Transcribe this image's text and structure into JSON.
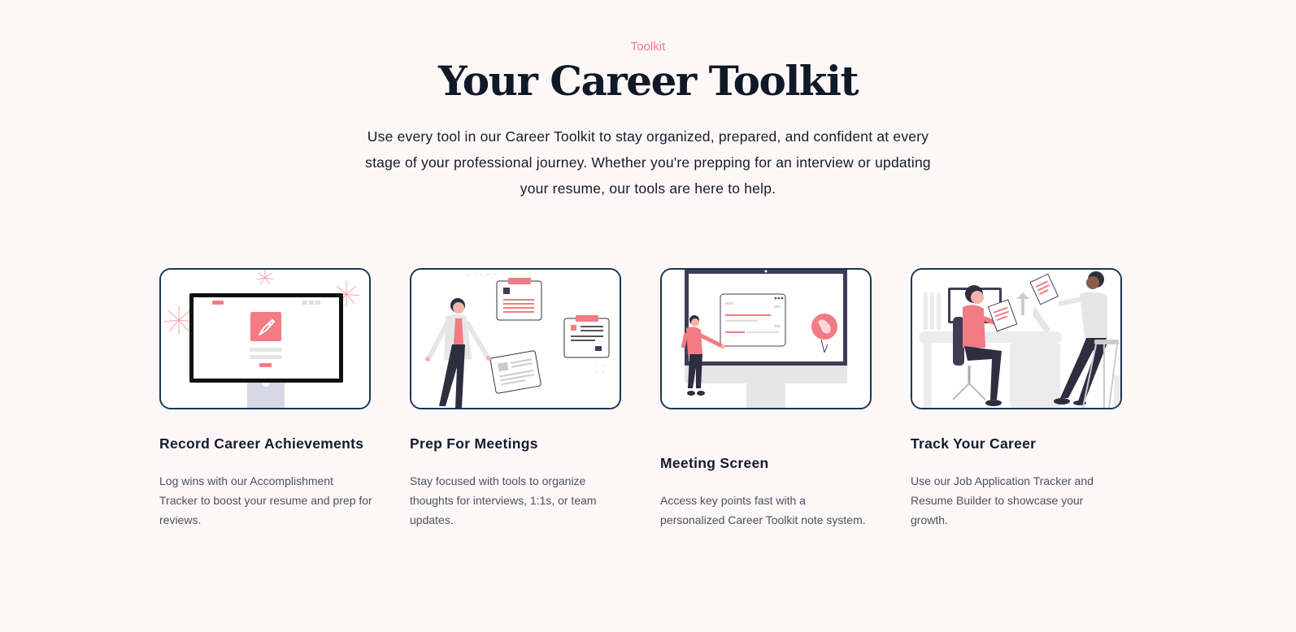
{
  "section": {
    "eyebrow": "Toolkit",
    "title": "Your Career Toolkit",
    "intro": "Use every tool in our Career Toolkit to stay organized, prepared, and confident at every stage of your professional journey. Whether you're prepping for an interview or updating your resume, our tools are here to help."
  },
  "colors": {
    "accent": "#f27b84",
    "frame_border": "#1b3557",
    "background": "#fdf8f7",
    "heading": "#111827"
  },
  "cards": [
    {
      "title": "Record Career Achievements",
      "description": "Log wins with our Accomplishment Tracker to boost your resume and prep for reviews.",
      "illustration": "monitor-rocket-fireworks"
    },
    {
      "title": "Prep For Meetings",
      "description": "Stay focused with tools to organize thoughts for interviews, 1:1s, or team updates.",
      "illustration": "woman-with-documents"
    },
    {
      "title": "Meeting Screen",
      "description": "Access key points fast with a personalized Career Toolkit note system.",
      "illustration": "person-at-large-screen"
    },
    {
      "title": "Track Your Career",
      "description": "Use our Job Application Tracker and Resume Builder to showcase your growth.",
      "illustration": "two-people-office"
    }
  ]
}
